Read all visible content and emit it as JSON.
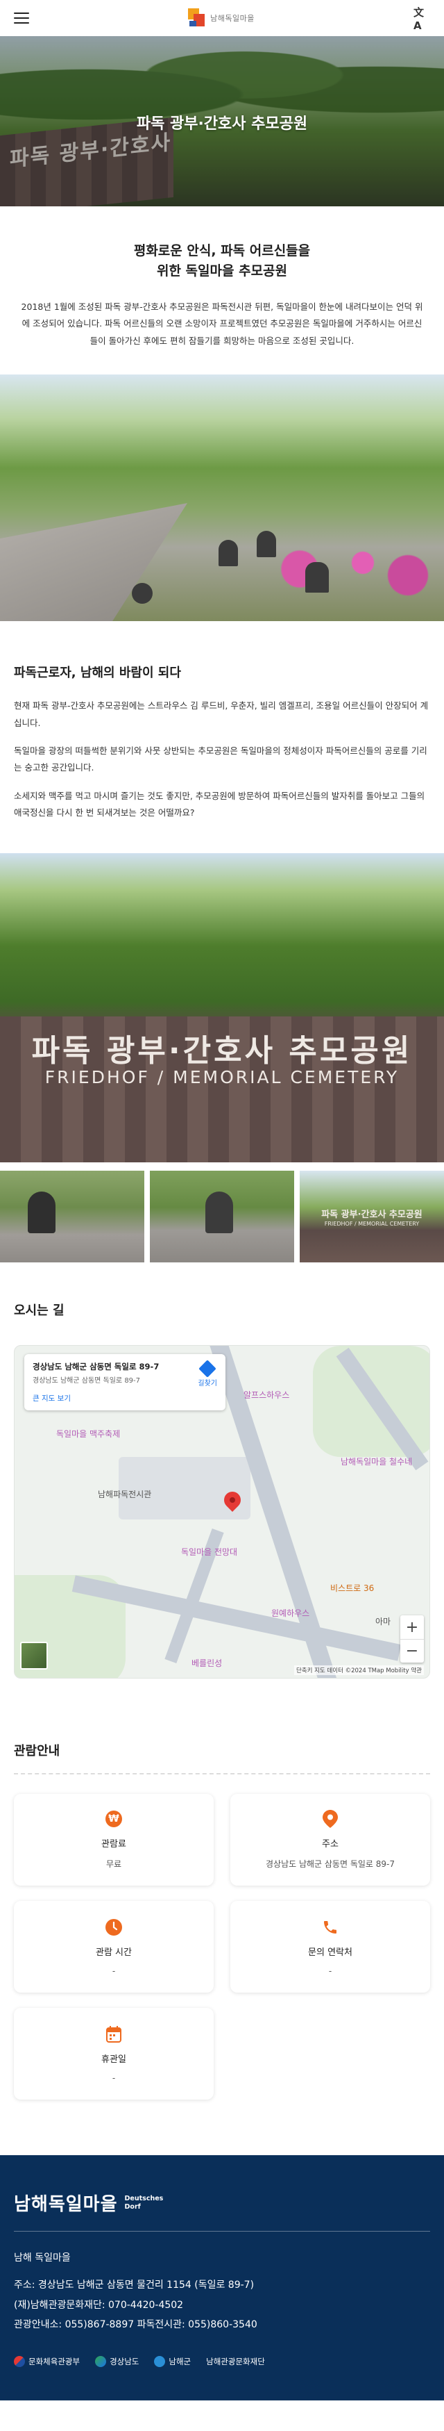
{
  "header": {
    "logo_text": "남해독일마을",
    "menu_icon": "hamburger-icon",
    "translate_icon": "translate-icon",
    "translate_glyph": "文A"
  },
  "hero": {
    "title": "파독 광부·간호사 추모공원",
    "sign_text": "파독 광부·간호사"
  },
  "intro": {
    "heading_line1": "평화로운 안식, 파독 어르신들을",
    "heading_line2": "위한 독일마을 추모공원",
    "body": "2018년 1월에 조성된 파독 광부-간호사 추모공원은 파독전시관 뒤편, 독일마을이 한눈에 내려다보이는 언덕 위에 조성되어 있습니다. 파독 어르신들의 오랜 소망이자 프로젝트였던 추모공원은 독일마을에 거주하시는 어르신들이 돌아가신 후에도 편히 잠들기를 희망하는 마음으로 조성된 곳입니다."
  },
  "story": {
    "title": "파독근로자, 남해의 바람이 되다",
    "paragraphs": [
      "현재 파독 광부-간호사 추모공원에는 스트라우스 김 루드비, 우춘자, 빌리 엠겔프리, 조용일 어르신들이 안장되어 계십니다.",
      "독일마을 광장의 떠들썩한 분위기와 사뭇 상반되는 추모공원은 독일마을의 정체성이자 파독어르신들의 공로를 기리는 숭고한 공간입니다.",
      "소세지와 맥주를 먹고 마시며 즐기는 것도 좋지만, 추모공원에 방문하여 파독어르신들의 발자취를 돌아보고 그들의 애국정신을 다시 한 번 되새겨보는 것은 어떨까요?"
    ]
  },
  "sign": {
    "title": "파독 광부·간호사 추모공원",
    "subtitle": "FRIEDHOF / MEMORIAL CEMETERY"
  },
  "gallery_sign": {
    "title": "파독 광부·간호사 추모공원",
    "subtitle": "FRIEDHOF / MEMORIAL CEMETERY"
  },
  "directions": {
    "title": "오시는 길",
    "card_address": "경상남도 남해군 삼동면 독일로 89-7",
    "card_address_sub": "경상남도 남해군 삼동면 독일로 89-7",
    "card_link": "큰 지도 보기",
    "card_directions": "길찾기",
    "labels": {
      "l1": "알프스하우스",
      "l2": "독일마을 맥주축제",
      "l3": "남해파독전시관",
      "l4": "남해독일마을 철수네",
      "l5": "독일마을 전망대",
      "l6": "비스트로 36",
      "l7": "원예하우스",
      "l8": "아마",
      "l9": "베를린성"
    },
    "zoom_in": "+",
    "zoom_out": "−",
    "map_footer": "단축키   지도 데이터 ©2024 TMap Mobility   약관"
  },
  "info": {
    "title": "관람안내",
    "items": [
      {
        "icon": "won-icon",
        "glyph": "₩",
        "label": "관람료",
        "value": "무료"
      },
      {
        "icon": "location-pin-icon",
        "glyph": "",
        "label": "주소",
        "value": "경상남도 남해군 삼동면 독일로 89-7"
      },
      {
        "icon": "clock-icon",
        "glyph": "",
        "label": "관람 시간",
        "value": "-"
      },
      {
        "icon": "phone-icon",
        "glyph": "",
        "label": "문의 연락처",
        "value": "-"
      },
      {
        "icon": "calendar-icon",
        "glyph": "",
        "label": "휴관일",
        "value": "-"
      }
    ]
  },
  "footer": {
    "logo_kr": "남해독일마을",
    "logo_de_1": "Deutsches",
    "logo_de_2": "Dorf",
    "name": "남해 독일마을",
    "address": "주소: 경상남도 남해군 삼동면 물건리 1154 (독일로 89-7)",
    "association": "(재)남해관광문화재단: 070-4420-4502",
    "contact": "관광안내소: 055)867-8897  파독전시관: 055)860-3540",
    "partners": [
      "문화체육관광부",
      "경상남도",
      "남해군",
      "남해관광문화재단"
    ]
  },
  "colors": {
    "accent": "#ee6a1f",
    "footer_bg": "#0a2f59",
    "map_pin": "#e53935",
    "link": "#1a73e8"
  }
}
